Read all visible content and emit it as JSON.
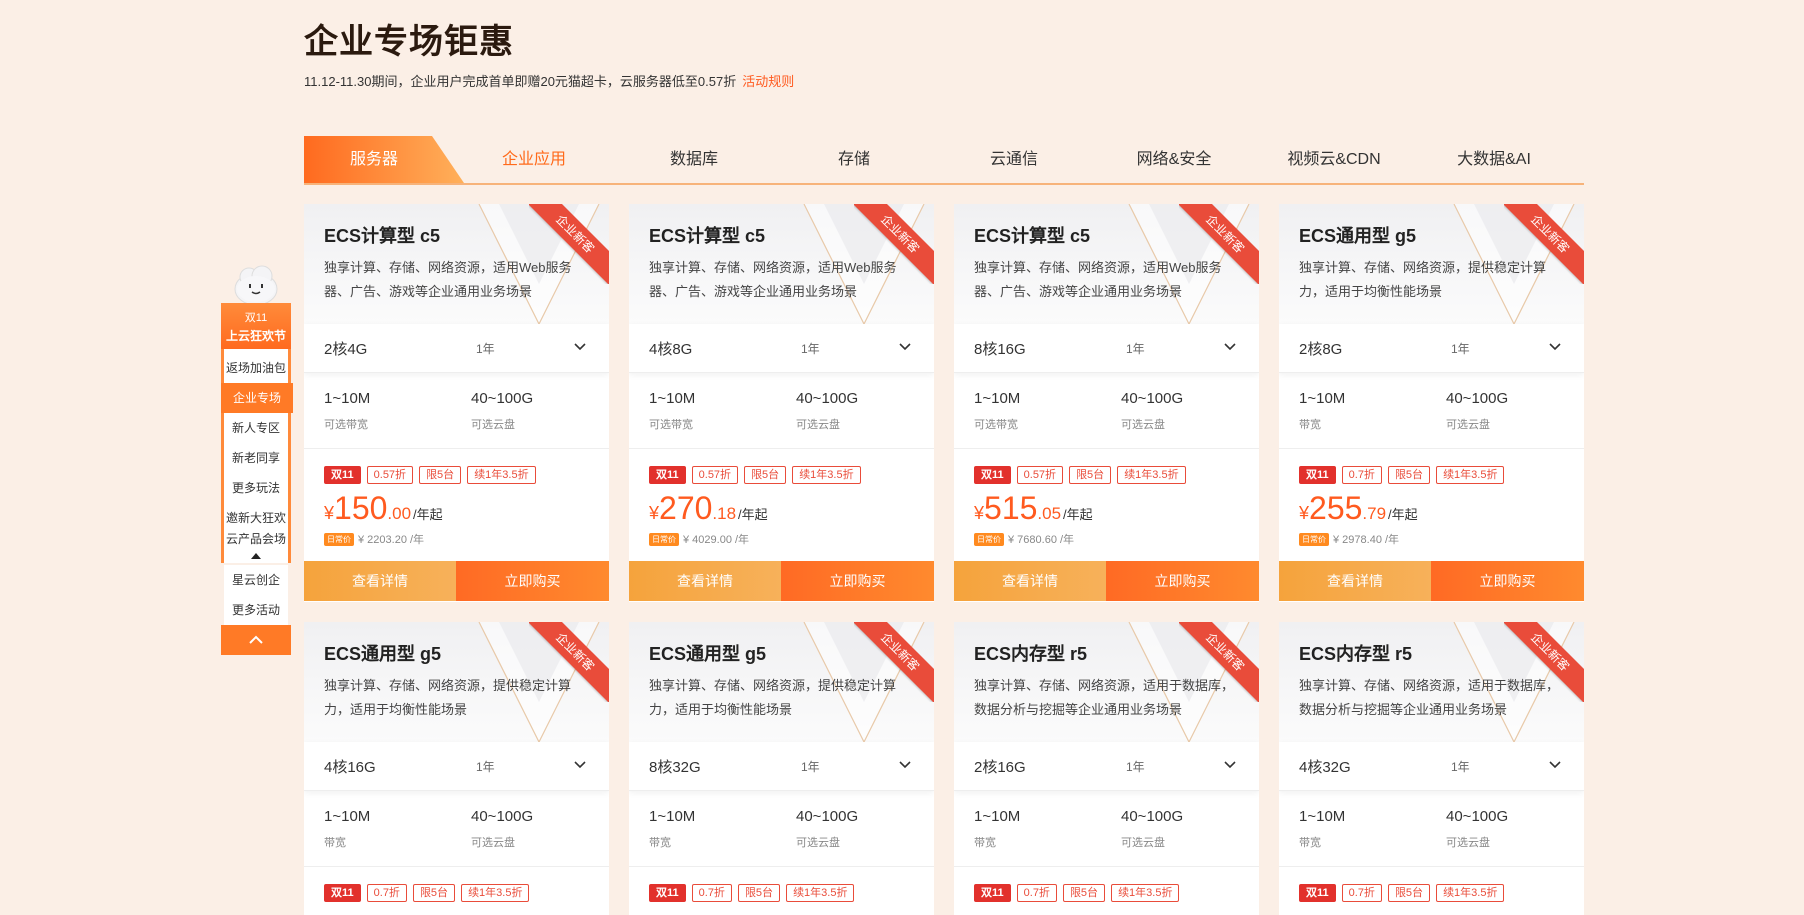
{
  "header": {
    "title": "企业专场钜惠",
    "subtitle": "11.12-11.30期间，企业用户完成首单即赠20元猫超卡，云服务器低至0.57折",
    "rules_link": "活动规则"
  },
  "tabs": [
    "服务器",
    "企业应用",
    "数据库",
    "存储",
    "云通信",
    "网络&安全",
    "视频云&CDN",
    "大数据&AI"
  ],
  "sidenav": {
    "head_line1": "双11",
    "head_line2": "上云狂欢节",
    "items": [
      "返场加油包",
      "企业专场",
      "新人专区",
      "新老同享",
      "更多玩法",
      "邀新大狂欢",
      "云产品会场",
      "星云创企",
      "更多活动"
    ]
  },
  "card_common": {
    "ribbon": "企业新客",
    "buy_label": "立即购买",
    "detail_label": "查看详情",
    "tag_double11": "双11",
    "tag_limit": "限5台",
    "tag_renew": "续1年3.5折",
    "daily_badge": "日常价",
    "currency": "¥",
    "per_year": "/年起"
  },
  "cards": [
    {
      "name": "ECS计算型 c5",
      "desc": "独享计算、存储、网络资源，适用Web服务器、广告、游戏等企业通用业务场景",
      "spec": "2核4G",
      "term": "1年",
      "bw": "1~10M",
      "bw_label": "可选带宽",
      "disk": "40~100G",
      "disk_label": "可选云盘",
      "discount": "0.57折",
      "price_int": "150",
      "price_dec": ".00",
      "orig": "¥ 2203.20 /年"
    },
    {
      "name": "ECS计算型 c5",
      "desc": "独享计算、存储、网络资源，适用Web服务器、广告、游戏等企业通用业务场景",
      "spec": "4核8G",
      "term": "1年",
      "bw": "1~10M",
      "bw_label": "可选带宽",
      "disk": "40~100G",
      "disk_label": "可选云盘",
      "discount": "0.57折",
      "price_int": "270",
      "price_dec": ".18",
      "orig": "¥ 4029.00 /年"
    },
    {
      "name": "ECS计算型 c5",
      "desc": "独享计算、存储、网络资源，适用Web服务器、广告、游戏等企业通用业务场景",
      "spec": "8核16G",
      "term": "1年",
      "bw": "1~10M",
      "bw_label": "可选带宽",
      "disk": "40~100G",
      "disk_label": "可选云盘",
      "discount": "0.57折",
      "price_int": "515",
      "price_dec": ".05",
      "orig": "¥ 7680.60 /年"
    },
    {
      "name": "ECS通用型 g5",
      "desc": "独享计算、存储、网络资源，提供稳定计算力，适用于均衡性能场景",
      "spec": "2核8G",
      "term": "1年",
      "bw": "1~10M",
      "bw_label": "带宽",
      "disk": "40~100G",
      "disk_label": "可选云盘",
      "discount": "0.7折",
      "price_int": "255",
      "price_dec": ".79",
      "orig": "¥ 2978.40 /年"
    },
    {
      "name": "ECS通用型 g5",
      "desc": "独享计算、存储、网络资源，提供稳定计算力，适用于均衡性能场景",
      "spec": "4核16G",
      "term": "1年",
      "bw": "1~10M",
      "bw_label": "带宽",
      "disk": "40~100G",
      "disk_label": "可选云盘",
      "discount": "0.7折"
    },
    {
      "name": "ECS通用型 g5",
      "desc": "独享计算、存储、网络资源，提供稳定计算力，适用于均衡性能场景",
      "spec": "8核32G",
      "term": "1年",
      "bw": "1~10M",
      "bw_label": "带宽",
      "disk": "40~100G",
      "disk_label": "可选云盘",
      "discount": "0.7折"
    },
    {
      "name": "ECS内存型 r5",
      "desc": "独享计算、存储、网络资源，适用于数据库，数据分析与挖掘等企业通用业务场景",
      "spec": "2核16G",
      "term": "1年",
      "bw": "1~10M",
      "bw_label": "带宽",
      "disk": "40~100G",
      "disk_label": "可选云盘",
      "discount": "0.7折"
    },
    {
      "name": "ECS内存型 r5",
      "desc": "独享计算、存储、网络资源，适用于数据库，数据分析与挖掘等企业通用业务场景",
      "spec": "4核32G",
      "term": "1年",
      "bw": "1~10M",
      "bw_label": "带宽",
      "disk": "40~100G",
      "disk_label": "可选云盘",
      "discount": "0.7折"
    }
  ],
  "colors": {
    "accent": "#ff6a1f",
    "tag_red": "#e2312c",
    "bg": "#fbefe6"
  }
}
